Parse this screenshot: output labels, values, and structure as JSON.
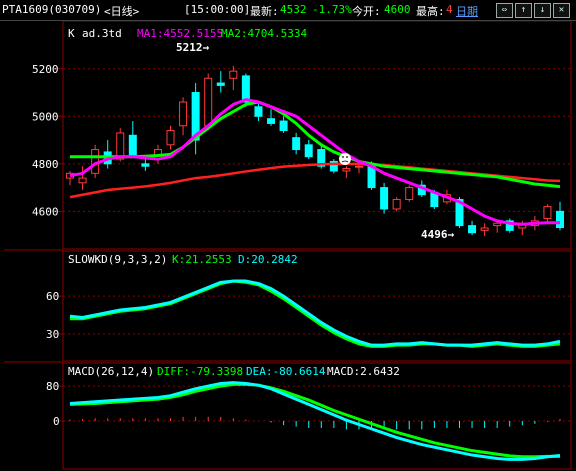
{
  "header": {
    "symbol": "PTA1609(030709)",
    "period": "<日线>",
    "time": "[15:00:00]",
    "latest_label": "最新:",
    "latest_value": "4532",
    "change": "-1.73%",
    "open_label": "今开:",
    "open_value": "4600",
    "high_label": "最高:",
    "high_value": "4",
    "link": "日期",
    "nav_icons": [
      "arrow-left-right-icon",
      "arrow-up-icon",
      "arrow-down-icon",
      "close-icon"
    ],
    "nav_glyphs": [
      "⇔",
      "↑",
      "↓",
      "✕"
    ]
  },
  "colors": {
    "up": "#ff3b3b",
    "down": "#00ffff",
    "ma1": "#ff00ff",
    "ma2": "#00ff00",
    "ma_long": "#ff2020",
    "grid": "#8b0000",
    "axis_text": "#ffffff",
    "label_white": "#ffffff",
    "label_green": "#00ff00",
    "label_cyan": "#00ffff",
    "label_magenta": "#ff00ff"
  },
  "panels": {
    "price": {
      "name": "K",
      "indicator": "ad.3td",
      "ma1_label": "MA1:4552.5155",
      "ma2_label": "MA2:4704.5334",
      "ticks": [
        "5200",
        "5000",
        "4800",
        "4600"
      ],
      "high_marker": "5212→",
      "low_marker": "4496→"
    },
    "slowkd": {
      "name": "SLOWKD(9,3,3,2)",
      "k_label": "K:21.2553",
      "d_label": "D:20.2842",
      "ticks": [
        "60",
        "30"
      ]
    },
    "macd": {
      "name": "MACD(26,12,4)",
      "diff_label": "DIFF:-79.3398",
      "dea_label": "DEA:-80.6614",
      "macd_label": "MACD:2.6432",
      "ticks": [
        "80",
        "0"
      ]
    }
  },
  "chart_data": {
    "type": "candlestick",
    "ylim": [
      4450,
      5300
    ],
    "candles": [
      {
        "o": 4740,
        "h": 4770,
        "l": 4710,
        "c": 4760
      },
      {
        "o": 4720,
        "h": 4790,
        "l": 4690,
        "c": 4740
      },
      {
        "o": 4760,
        "h": 4880,
        "l": 4740,
        "c": 4860
      },
      {
        "o": 4850,
        "h": 4900,
        "l": 4780,
        "c": 4800
      },
      {
        "o": 4820,
        "h": 4950,
        "l": 4810,
        "c": 4930
      },
      {
        "o": 4920,
        "h": 4980,
        "l": 4830,
        "c": 4830
      },
      {
        "o": 4800,
        "h": 4820,
        "l": 4770,
        "c": 4790
      },
      {
        "o": 4820,
        "h": 4880,
        "l": 4800,
        "c": 4860
      },
      {
        "o": 4880,
        "h": 4960,
        "l": 4860,
        "c": 4940
      },
      {
        "o": 4960,
        "h": 5080,
        "l": 4920,
        "c": 5060
      },
      {
        "o": 5100,
        "h": 5140,
        "l": 4840,
        "c": 4900
      },
      {
        "o": 4960,
        "h": 5180,
        "l": 4940,
        "c": 5160
      },
      {
        "o": 5140,
        "h": 5190,
        "l": 5100,
        "c": 5130
      },
      {
        "o": 5160,
        "h": 5212,
        "l": 5110,
        "c": 5190
      },
      {
        "o": 5170,
        "h": 5180,
        "l": 5040,
        "c": 5060
      },
      {
        "o": 5040,
        "h": 5060,
        "l": 4980,
        "c": 5000
      },
      {
        "o": 4990,
        "h": 5030,
        "l": 4960,
        "c": 4970
      },
      {
        "o": 4980,
        "h": 5000,
        "l": 4930,
        "c": 4940
      },
      {
        "o": 4910,
        "h": 4930,
        "l": 4840,
        "c": 4860
      },
      {
        "o": 4880,
        "h": 4900,
        "l": 4820,
        "c": 4830
      },
      {
        "o": 4860,
        "h": 4880,
        "l": 4780,
        "c": 4790
      },
      {
        "o": 4810,
        "h": 4820,
        "l": 4760,
        "c": 4770
      },
      {
        "o": 4770,
        "h": 4790,
        "l": 4740,
        "c": 4780
      },
      {
        "o": 4790,
        "h": 4800,
        "l": 4760,
        "c": 4790
      },
      {
        "o": 4790,
        "h": 4810,
        "l": 4690,
        "c": 4700
      },
      {
        "o": 4700,
        "h": 4720,
        "l": 4590,
        "c": 4610
      },
      {
        "o": 4610,
        "h": 4660,
        "l": 4600,
        "c": 4650
      },
      {
        "o": 4650,
        "h": 4710,
        "l": 4640,
        "c": 4700
      },
      {
        "o": 4710,
        "h": 4730,
        "l": 4660,
        "c": 4670
      },
      {
        "o": 4680,
        "h": 4690,
        "l": 4610,
        "c": 4620
      },
      {
        "o": 4640,
        "h": 4690,
        "l": 4630,
        "c": 4670
      },
      {
        "o": 4650,
        "h": 4660,
        "l": 4530,
        "c": 4540
      },
      {
        "o": 4540,
        "h": 4560,
        "l": 4500,
        "c": 4510
      },
      {
        "o": 4520,
        "h": 4550,
        "l": 4496,
        "c": 4530
      },
      {
        "o": 4540,
        "h": 4560,
        "l": 4510,
        "c": 4550
      },
      {
        "o": 4560,
        "h": 4570,
        "l": 4510,
        "c": 4520
      },
      {
        "o": 4530,
        "h": 4560,
        "l": 4500,
        "c": 4550
      },
      {
        "o": 4540,
        "h": 4580,
        "l": 4520,
        "c": 4560
      },
      {
        "o": 4570,
        "h": 4630,
        "l": 4550,
        "c": 4620
      },
      {
        "o": 4600,
        "h": 4640,
        "l": 4520,
        "c": 4532
      }
    ],
    "ma1": [
      4750,
      4760,
      4800,
      4820,
      4830,
      4830,
      4825,
      4820,
      4830,
      4870,
      4920,
      4960,
      5010,
      5050,
      5070,
      5060,
      5040,
      5020,
      5000,
      4960,
      4920,
      4880,
      4840,
      4810,
      4790,
      4760,
      4740,
      4720,
      4700,
      4680,
      4660,
      4640,
      4610,
      4580,
      4560,
      4550,
      4545,
      4550,
      4552,
      4552
    ],
    "ma2": [
      4830,
      4830,
      4830,
      4830,
      4830,
      4830,
      4832,
      4835,
      4840,
      4870,
      4910,
      4950,
      4990,
      5020,
      5050,
      5060,
      5040,
      5010,
      4970,
      4920,
      4880,
      4850,
      4830,
      4810,
      4800,
      4790,
      4785,
      4780,
      4775,
      4770,
      4765,
      4760,
      4755,
      4750,
      4745,
      4735,
      4725,
      4715,
      4710,
      4704
    ],
    "ma_long": [
      4660,
      4670,
      4680,
      4690,
      4695,
      4700,
      4705,
      4712,
      4720,
      4730,
      4740,
      4745,
      4752,
      4760,
      4768,
      4775,
      4782,
      4788,
      4792,
      4795,
      4798,
      4800,
      4800,
      4800,
      4798,
      4795,
      4790,
      4785,
      4780,
      4775,
      4770,
      4765,
      4760,
      4755,
      4750,
      4745,
      4740,
      4735,
      4730,
      4728
    ],
    "slowkd": {
      "ylim": [
        10,
        80
      ],
      "k": [
        44,
        43,
        45,
        47,
        49,
        50,
        51,
        53,
        55,
        59,
        63,
        67,
        71,
        72,
        72,
        70,
        66,
        60,
        53,
        46,
        39,
        33,
        28,
        24,
        21,
        21,
        22,
        22,
        23,
        22,
        21,
        21,
        21,
        22,
        23,
        22,
        21,
        21,
        22,
        24
      ],
      "d": [
        42,
        42,
        44,
        46,
        48,
        49,
        50,
        52,
        54,
        58,
        62,
        66,
        70,
        72,
        71,
        69,
        64,
        58,
        51,
        44,
        37,
        31,
        26,
        22,
        20,
        20,
        21,
        21,
        22,
        22,
        21,
        21,
        20,
        21,
        22,
        21,
        20,
        20,
        21,
        22
      ]
    },
    "macd": {
      "ylim": [
        -110,
        110
      ],
      "diff": [
        40,
        42,
        44,
        46,
        48,
        50,
        52,
        54,
        58,
        66,
        74,
        80,
        86,
        88,
        86,
        82,
        74,
        62,
        50,
        38,
        26,
        14,
        2,
        -8,
        -18,
        -28,
        -38,
        -46,
        -54,
        -60,
        -66,
        -72,
        -78,
        -82,
        -86,
        -88,
        -88,
        -86,
        -82,
        -79
      ],
      "dea": [
        38,
        39,
        40,
        42,
        44,
        46,
        48,
        50,
        54,
        60,
        68,
        74,
        80,
        84,
        84,
        82,
        76,
        68,
        58,
        48,
        36,
        24,
        14,
        4,
        -6,
        -16,
        -26,
        -34,
        -42,
        -50,
        -56,
        -62,
        -68,
        -72,
        -76,
        -80,
        -82,
        -82,
        -81,
        -81
      ],
      "hist": [
        2,
        3,
        4,
        4,
        4,
        4,
        4,
        4,
        4,
        6,
        6,
        6,
        6,
        4,
        2,
        0,
        -2,
        -6,
        -8,
        -10,
        -10,
        -10,
        -12,
        -12,
        -12,
        -12,
        -12,
        -12,
        -12,
        -10,
        -10,
        -10,
        -10,
        -10,
        -10,
        -8,
        -6,
        -4,
        -1,
        3
      ]
    }
  }
}
